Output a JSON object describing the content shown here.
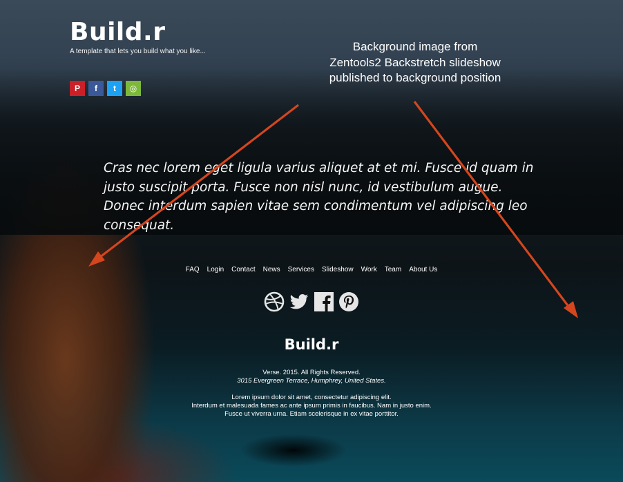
{
  "header": {
    "brand": "Build.r",
    "tagline": "A template that lets you build what you like..."
  },
  "social_small": [
    {
      "name": "pinterest",
      "glyph": "P",
      "color": "#cb2027"
    },
    {
      "name": "facebook",
      "glyph": "f",
      "color": "#3b5998"
    },
    {
      "name": "twitter",
      "glyph": "t",
      "color": "#1da1f2"
    },
    {
      "name": "dribbble",
      "glyph": "◎",
      "color": "#7db83a"
    }
  ],
  "annotation": {
    "line1": "Background image from",
    "line2": "Zentools2 Backstretch slideshow",
    "line3": "published to background position",
    "arrow_color": "#d4461e"
  },
  "quote": "Cras nec lorem eget ligula varius aliquet at et mi. Fusce id quam in justo suscipit porta. Fusce non nisl nunc, id vestibulum augue. Donec interdum sapien vitae sem condimentum vel adipiscing leo consequat.",
  "nav": [
    "FAQ",
    "Login",
    "Contact",
    "News",
    "Services",
    "Slideshow",
    "Work",
    "Team",
    "About Us"
  ],
  "social_large": [
    "dribbble-icon",
    "twitter-icon",
    "facebook-icon",
    "pinterest-icon"
  ],
  "footer": {
    "brand": "Build.r",
    "copyright": "Verse. 2015. All Rights Reserved.",
    "address": "3015 Evergreen Terrace, Humphrey, United States.",
    "lorem1": "Lorem ipsum dolor sit amet, consectetur adipiscing elit.",
    "lorem2": "Interdum et malesuada fames ac ante ipsum primis in faucibus. Nam in justo enim.",
    "lorem3": "Fusce ut viverra urna. Etiam scelerisque in ex vitae porttitor."
  }
}
